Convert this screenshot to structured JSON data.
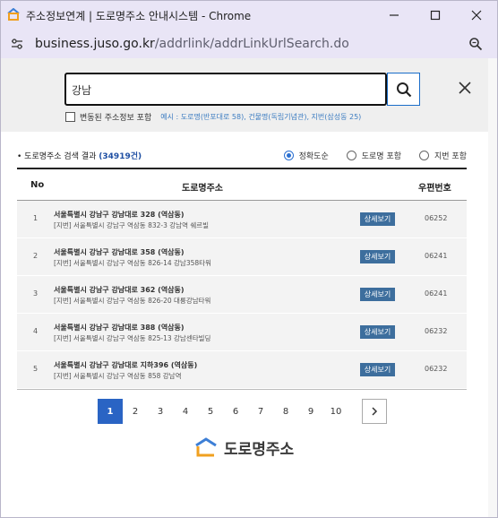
{
  "window": {
    "title": "주소정보연계 | 도로명주소 안내시스템 - Chrome",
    "url_host": "business.juso.go.kr",
    "url_path": "/addrlink/addrLinkUrlSearch.do"
  },
  "search": {
    "value": "강남",
    "checkbox_label": "변동된 주소정보 포함",
    "example": "예시 : 도로명(반포대로 58), 건물명(독립기념관), 지번(삼성동 25)"
  },
  "results": {
    "title_prefix": "도로명주소 검색 결과",
    "count": "(34919건)",
    "sort_options": [
      "정확도순",
      "도로명 포함",
      "지번 포함"
    ],
    "sort_selected": "정확도순",
    "columns": {
      "no": "No",
      "address": "도로명주소",
      "zip": "우편번호"
    },
    "detail_label": "상세보기",
    "rows": [
      {
        "no": "1",
        "road": "서울특별시 강남구 강남대로 328 (역삼동)",
        "jibun": "[지번] 서울특별시 강남구 역삼동 832-3 강남역 쉐르빌",
        "zip": "06252"
      },
      {
        "no": "2",
        "road": "서울특별시 강남구 강남대로 358 (역삼동)",
        "jibun": "[지번] 서울특별시 강남구 역삼동 826-14 강남358타워",
        "zip": "06241"
      },
      {
        "no": "3",
        "road": "서울특별시 강남구 강남대로 362 (역삼동)",
        "jibun": "[지번] 서울특별시 강남구 역삼동 826-20 대륭강남타워",
        "zip": "06241"
      },
      {
        "no": "4",
        "road": "서울특별시 강남구 강남대로 388 (역삼동)",
        "jibun": "[지번] 서울특별시 강남구 역삼동 825-13 강남센타빌딩",
        "zip": "06232"
      },
      {
        "no": "5",
        "road": "서울특별시 강남구 강남대로 지하396 (역삼동)",
        "jibun": "[지번] 서울특별시 강남구 역삼동 858 강남역",
        "zip": "06232"
      }
    ]
  },
  "pagination": {
    "pages": [
      "1",
      "2",
      "3",
      "4",
      "5",
      "6",
      "7",
      "8",
      "9",
      "10"
    ],
    "current": "1"
  },
  "logo": {
    "text": "도로명주소"
  },
  "colors": {
    "accent": "#2a64c4",
    "detail_button": "#3d6e9d",
    "titlebar": "#e9e5f6"
  }
}
